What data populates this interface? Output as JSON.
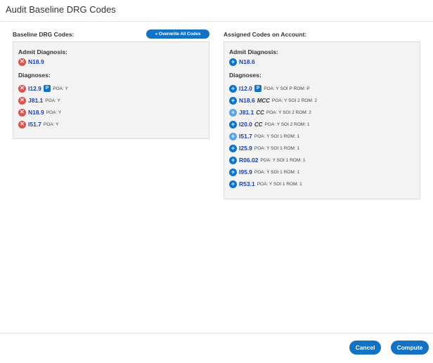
{
  "dialog": {
    "title": "Audit Baseline DRG Codes"
  },
  "baseline": {
    "heading": "Baseline DRG Codes:",
    "overwrite_label": "« Overwrite All Codes",
    "admit_label": "Admit Diagnosis:",
    "admit": {
      "code": "N18.9",
      "icon": "remove-icon"
    },
    "diagnoses_label": "Diagnoses:",
    "diagnoses": [
      {
        "code": "I12.9",
        "badge": "P",
        "meta": "POA: Y",
        "icon": "remove-icon"
      },
      {
        "code": "J81.1",
        "meta": "POA: Y",
        "icon": "remove-icon"
      },
      {
        "code": "N18.9",
        "meta": "POA: Y",
        "icon": "remove-icon"
      },
      {
        "code": "I51.7",
        "meta": "POA: Y",
        "icon": "remove-icon"
      }
    ]
  },
  "assigned": {
    "heading": "Assigned Codes on Account:",
    "admit_label": "Admit Diagnosis:",
    "admit": {
      "code": "N18.6",
      "icon": "add-icon"
    },
    "diagnoses_label": "Diagnoses:",
    "diagnoses": [
      {
        "code": "I12.0",
        "badge": "P",
        "meta": "POA: Y SOI P ROM: P",
        "icon": "add-icon"
      },
      {
        "code": "N18.6",
        "tag": "MCC",
        "meta": "POA: Y SOI 2 ROM: 2",
        "icon": "add-icon"
      },
      {
        "code": "J81.1",
        "tag": "CC",
        "meta": "POA: Y SOI 2 ROM: 2",
        "icon": "add-icon-light"
      },
      {
        "code": "I20.0",
        "tag": "CC",
        "meta": "POA: Y SOI 2 ROM: 1",
        "icon": "add-icon"
      },
      {
        "code": "I51.7",
        "meta": "POA: Y SOI 1 ROM: 1",
        "icon": "add-icon-light"
      },
      {
        "code": "I25.9",
        "meta": "POA: Y SOI 1 ROM: 1",
        "icon": "add-icon"
      },
      {
        "code": "R06.02",
        "meta": "POA: Y SOI 1 ROM: 1",
        "icon": "add-icon"
      },
      {
        "code": "I95.9",
        "meta": "POA: Y SOI 1 ROM: 1",
        "icon": "add-icon"
      },
      {
        "code": "R53.1",
        "meta": "POA: Y SOI 1 ROM: 1",
        "icon": "add-icon"
      }
    ]
  },
  "footer": {
    "cancel_label": "Cancel",
    "compute_label": "Compute"
  },
  "colors": {
    "accent": "#1273c4",
    "remove": "#e0514b",
    "code_text": "#1c3fb5",
    "panel_bg": "#f3f3f3"
  }
}
